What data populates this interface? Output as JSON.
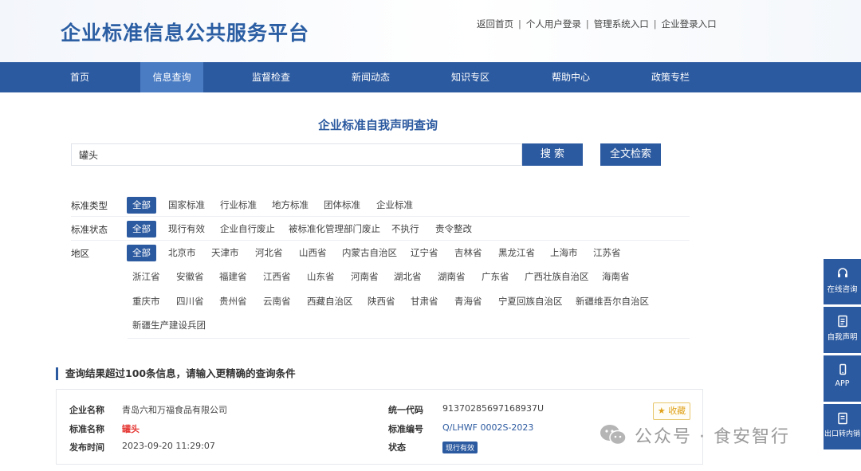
{
  "header": {
    "logo": "企业标准信息公共服务平台",
    "links": [
      "返回首页",
      "个人用户登录",
      "管理系统入口",
      "企业登录入口"
    ]
  },
  "nav": [
    "首页",
    "信息查询",
    "监督检查",
    "新闻动态",
    "知识专区",
    "帮助中心",
    "政策专栏"
  ],
  "page_title": "企业标准自我声明查询",
  "search": {
    "value": "罐头",
    "search_label": "搜 索",
    "fulltext_label": "全文检索"
  },
  "filters": {
    "type": {
      "label": "标准类型",
      "options": [
        "全部",
        "国家标准",
        "行业标准",
        "地方标准",
        "团体标准",
        "企业标准"
      ]
    },
    "status": {
      "label": "标准状态",
      "options": [
        "全部",
        "现行有效",
        "企业自行废止",
        "被标准化管理部门废止",
        "不执行",
        "责令整改"
      ]
    },
    "region": {
      "label": "地区",
      "row1": [
        "全部",
        "北京市",
        "天津市",
        "河北省",
        "山西省",
        "内蒙古自治区",
        "辽宁省",
        "吉林省",
        "黑龙江省",
        "上海市",
        "江苏省"
      ],
      "row2": [
        "浙江省",
        "安徽省",
        "福建省",
        "江西省",
        "山东省",
        "河南省",
        "湖北省",
        "湖南省",
        "广东省",
        "广西壮族自治区",
        "海南省"
      ],
      "row3": [
        "重庆市",
        "四川省",
        "贵州省",
        "云南省",
        "西藏自治区",
        "陕西省",
        "甘肃省",
        "青海省",
        "宁夏回族自治区",
        "新疆维吾尔自治区"
      ],
      "row4": [
        "新疆生产建设兵团"
      ]
    }
  },
  "result_notice": "查询结果超过100条信息，请输入更精确的查询条件",
  "result": {
    "company_label": "企业名称",
    "company": "青岛六和万福食品有限公司",
    "std_name_label": "标准名称",
    "std_name": "罐头",
    "publish_label": "发布时间",
    "publish": "2023-09-20 11:29:07",
    "credit_label": "统一代码",
    "credit": "91370285697168937U",
    "std_no_label": "标准编号",
    "std_no": "Q/LHWF 0002S-2023",
    "state_label": "状态",
    "state": "现行有效",
    "fav_label": "收藏"
  },
  "watermark": "公众号 · 食安智行",
  "side": [
    "在线咨询",
    "自我声明",
    "APP",
    "出口转内销"
  ],
  "colors": {
    "primary": "#2c5aa0",
    "nav_active": "#4a7cc4",
    "red": "#e53935"
  }
}
